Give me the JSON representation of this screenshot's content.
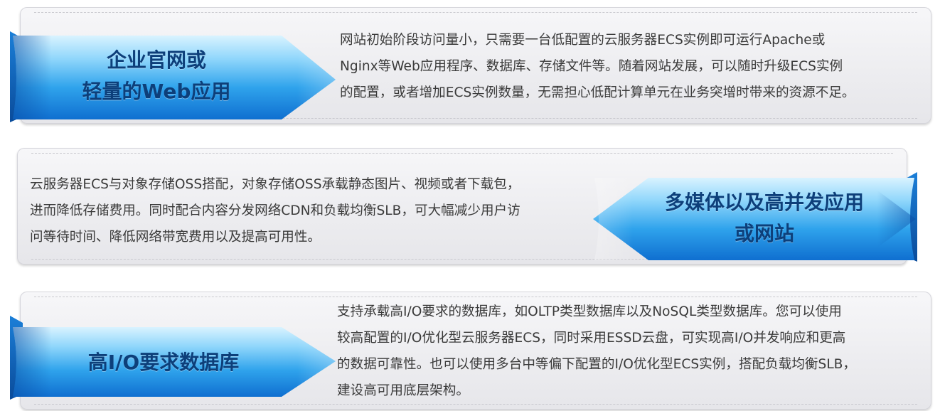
{
  "cards": [
    {
      "id": "web-app",
      "title_lines": [
        "企业官网或",
        "轻量的Web应用"
      ],
      "desc_lines": [
        "网站初始阶段访问量小，只需要一台低配置的云服务器ECS实例即可运行Apache或",
        "Nginx等Web应用程序、数据库、存储文件等。随着网站发展，可以随时升级ECS实例",
        "的配置，或者增加ECS实例数量，无需担心低配计算单元在业务突增时带来的资源不足。"
      ]
    },
    {
      "id": "multimedia",
      "title_lines": [
        "多媒体以及高并发应用",
        "或网站"
      ],
      "desc_lines": [
        "云服务器ECS与对象存储OSS搭配，对象存储OSS承载静态图片、视频或者下载包，",
        "进而降低存储费用。同时配合内容分发网络CDN和负载均衡SLB，可大幅减少用户访",
        "问等待时间、降低网络带宽费用以及提高可用性。"
      ]
    },
    {
      "id": "high-io-db",
      "title_lines": [
        "高I/O要求数据库"
      ],
      "desc_lines": [
        "支持承载高I/O要求的数据库，如OLTP类型数据库以及NoSQL类型数据库。您可以使用",
        "较高配置的I/O优化型云服务器ECS，同时采用ESSD云盘，可实现高I/O并发响应和更高",
        "的数据可靠性。也可以使用多台中等偏下配置的I/O优化型ECS实例，搭配负载均衡SLB，",
        "建设高可用底层架构。"
      ]
    }
  ],
  "colors": {
    "ribbon_light": "#cfeeff",
    "ribbon_mid": "#3ab0ee",
    "ribbon_dark": "#1172cf",
    "title_text": "#0d3f7a",
    "body_text": "#3a3a3a"
  }
}
